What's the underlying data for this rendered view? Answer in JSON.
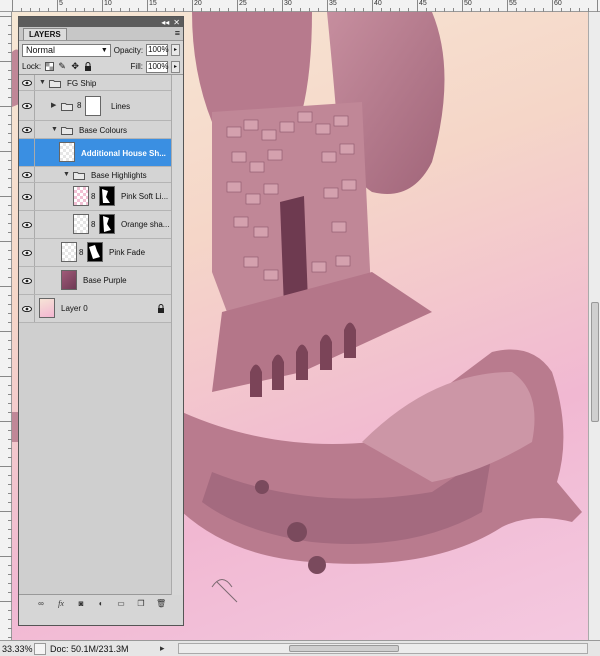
{
  "canvas": {
    "zoom": "33.33%",
    "doc_info": "Doc: 50.1M/231.3M"
  },
  "ruler": {
    "top_numbers": [
      "5",
      "10",
      "15",
      "20",
      "25",
      "30",
      "35",
      "40",
      "45",
      "50",
      "55",
      "60"
    ]
  },
  "panel": {
    "tab": "LAYERS",
    "blend_mode": "Normal",
    "opacity_label": "Opacity:",
    "opacity_value": "100%",
    "lock_label": "Lock:",
    "fill_label": "Fill:",
    "fill_value": "100%"
  },
  "layers": [
    {
      "name": "FG Ship",
      "type": "group"
    },
    {
      "name": "Lines",
      "type": "group"
    },
    {
      "name": "Base Colours",
      "type": "group"
    },
    {
      "name": "Additional House Sh...",
      "type": "layer",
      "selected": true
    },
    {
      "name": "Base Highlights",
      "type": "group"
    },
    {
      "name": "Pink Soft Li...",
      "type": "layer"
    },
    {
      "name": "Orange sha...",
      "type": "layer"
    },
    {
      "name": "Pink Fade",
      "type": "layer"
    },
    {
      "name": "Base Purple",
      "type": "layer"
    },
    {
      "name": "Layer 0",
      "type": "layer"
    }
  ],
  "bottom_icons": [
    "link-layers-icon",
    "fx-icon",
    "mask-icon",
    "adjustment-icon",
    "new-group-icon",
    "new-layer-icon",
    "trash-icon"
  ],
  "colors": {
    "selection": "#3a8fe2",
    "ship": "#b87a8e"
  }
}
